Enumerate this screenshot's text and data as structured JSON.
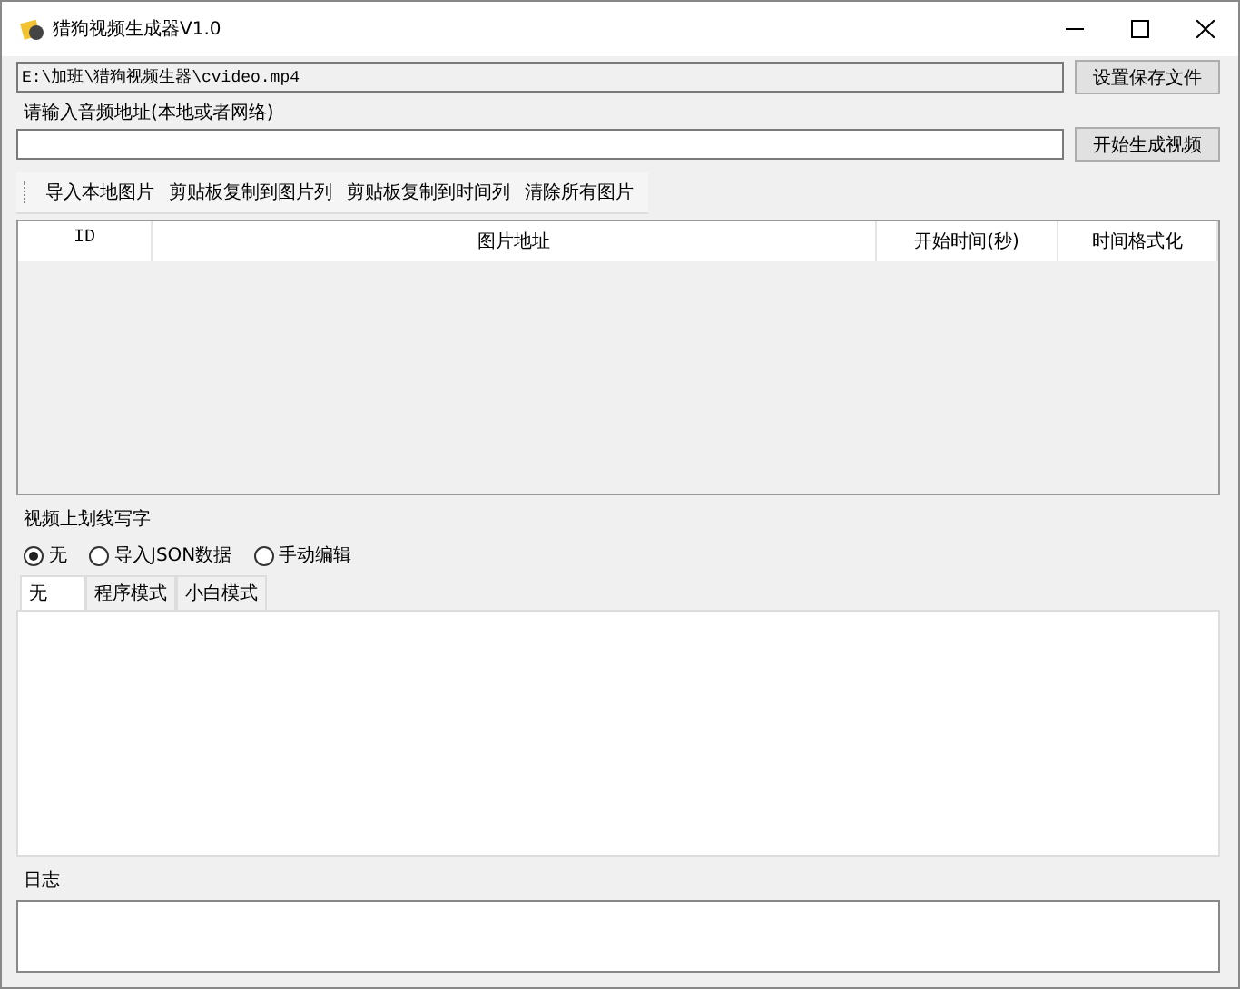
{
  "window": {
    "title": "猎狗视频生成器V1.0"
  },
  "output_path": {
    "value": "E:\\加班\\猎狗视频生器\\cvideo.mp4"
  },
  "save_button": "设置保存文件",
  "audio": {
    "label": "请输入音频地址(本地或者网络)"
  },
  "generate_button": "开始生成视频",
  "toolbar": [
    "导入本地图片",
    "剪贴板复制到图片列",
    "剪贴板复制到时间列",
    "清除所有图片"
  ],
  "table": {
    "columns": [
      "ID",
      "图片地址",
      "开始时间(秒)",
      "时间格式化"
    ]
  },
  "overlay": {
    "title": "视频上划线写字",
    "options": [
      {
        "label": "无",
        "selected": true
      },
      {
        "label": "导入JSON数据",
        "selected": false
      },
      {
        "label": "手动编辑",
        "selected": false
      }
    ],
    "tabs": [
      {
        "label": "无",
        "selected": true
      },
      {
        "label": "程序模式",
        "selected": false
      },
      {
        "label": "小白模式",
        "selected": false
      }
    ]
  },
  "log": {
    "title": "日志"
  }
}
